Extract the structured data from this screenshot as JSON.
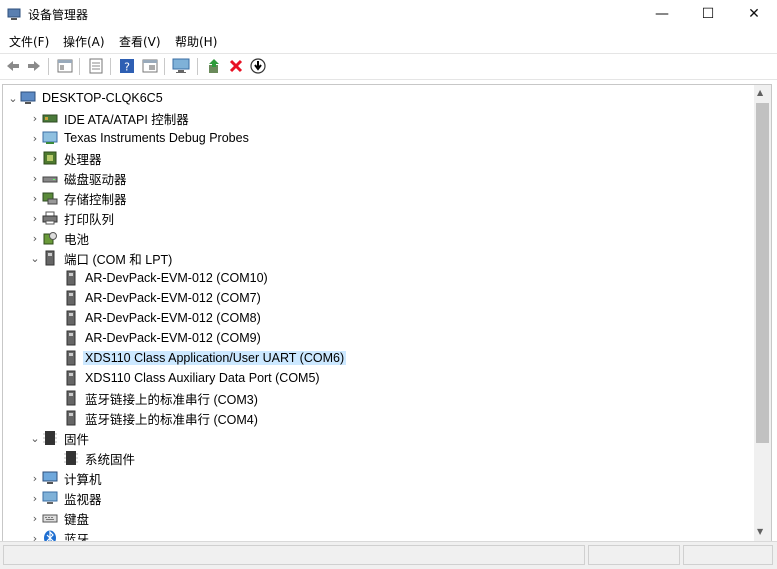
{
  "window": {
    "title": "设备管理器",
    "minimize_glyph": "—",
    "maximize_glyph": "☐",
    "close_glyph": "✕"
  },
  "menu": {
    "file": "文件(F)",
    "action": "操作(A)",
    "view": "查看(V)",
    "help": "帮助(H)"
  },
  "toolbar": {
    "icons": [
      "back-icon",
      "forward-icon",
      "properties-icon",
      "list-icon",
      "help-icon",
      "show-hidden-icon",
      "monitor-icon",
      "update-driver-icon",
      "uninstall-icon",
      "scan-hardware-icon"
    ]
  },
  "tree": {
    "root": "DESKTOP-CLQK6C5",
    "ide": "IDE ATA/ATAPI 控制器",
    "ti": "Texas Instruments Debug Probes",
    "cpu": "处理器",
    "disk": "磁盘驱动器",
    "storage": "存储控制器",
    "printq": "打印队列",
    "battery": "电池",
    "ports": "端口 (COM 和 LPT)",
    "com10": "AR-DevPack-EVM-012 (COM10)",
    "com7": "AR-DevPack-EVM-012 (COM7)",
    "com8": "AR-DevPack-EVM-012 (COM8)",
    "com9": "AR-DevPack-EVM-012 (COM9)",
    "com6": "XDS110 Class Application/User UART (COM6)",
    "com5": "XDS110 Class Auxiliary Data Port (COM5)",
    "com3": "蓝牙链接上的标准串行 (COM3)",
    "com4": "蓝牙链接上的标准串行 (COM4)",
    "firmware": "固件",
    "sysfw": "系统固件",
    "computer": "计算机",
    "monitor": "监视器",
    "keyboard": "键盘",
    "bluetooth": "蓝牙"
  },
  "colors": {
    "selection": "#cce8ff",
    "uninstall_red": "#e81123"
  }
}
